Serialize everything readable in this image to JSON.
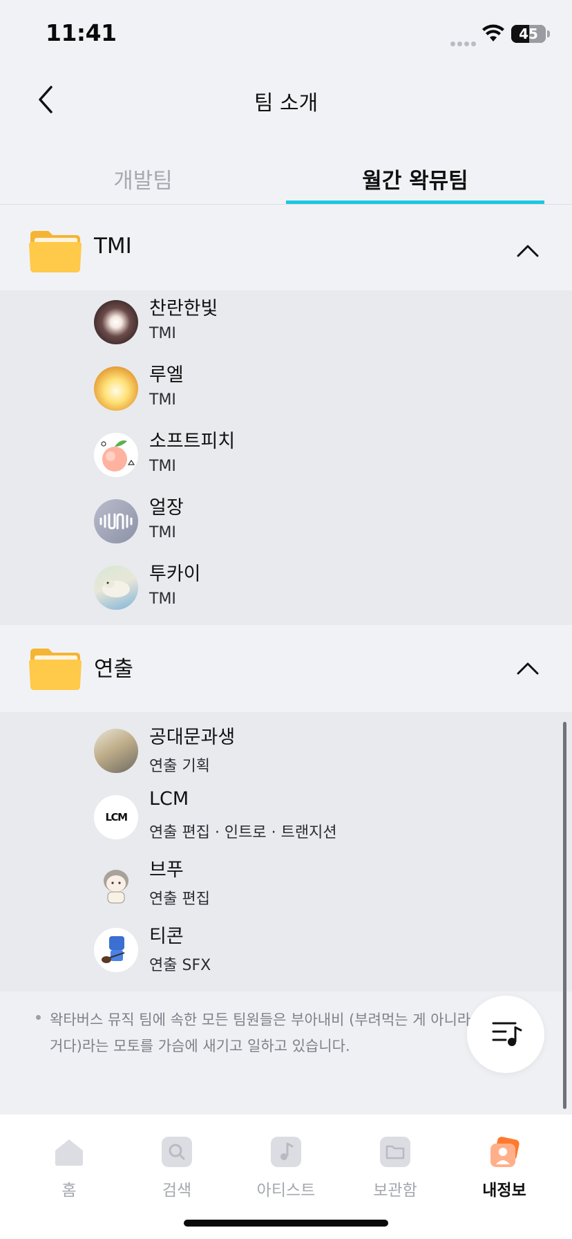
{
  "status_bar": {
    "time": "11:41",
    "battery": "45"
  },
  "header": {
    "title": "팀 소개"
  },
  "tabs": [
    {
      "label": "개발팀",
      "active": false
    },
    {
      "label": "월간 왁뮤팀",
      "active": true
    }
  ],
  "groups": [
    {
      "title": "TMI",
      "members": [
        {
          "name": "찬란한빛",
          "role": "TMI"
        },
        {
          "name": "루엘",
          "role": "TMI"
        },
        {
          "name": "소프트피치",
          "role": "TMI"
        },
        {
          "name": "얼장",
          "role": "TMI"
        },
        {
          "name": "투카이",
          "role": "TMI"
        }
      ]
    },
    {
      "title": "연출",
      "members": [
        {
          "name": "공대문과생",
          "role": "연출 기획"
        },
        {
          "name": "LCM",
          "role": "연출 편집 · 인트로 · 트랜지션",
          "avatar_text": "LCM"
        },
        {
          "name": "브푸",
          "role": "연출 편집"
        },
        {
          "name": "티콘",
          "role": "연출 SFX"
        }
      ]
    }
  ],
  "note": "왁타버스 뮤직 팀에 속한 모든 팀원들은 부아내비 (부려먹는 게 아니라 내가 비빈 거다)라는 모토를 가슴에 새기고 일하고 있습니다.",
  "bottom_nav": [
    {
      "label": "홈",
      "icon": "home-icon",
      "active": false
    },
    {
      "label": "검색",
      "icon": "search-icon",
      "active": false
    },
    {
      "label": "아티스트",
      "icon": "music-note-icon",
      "active": false
    },
    {
      "label": "보관함",
      "icon": "folder-icon",
      "active": false
    },
    {
      "label": "내정보",
      "icon": "profile-icon",
      "active": true
    }
  ],
  "colors": {
    "accent": "#1bc7e3",
    "folder": "#ffc94a",
    "active_nav": "#ff7a2e"
  }
}
